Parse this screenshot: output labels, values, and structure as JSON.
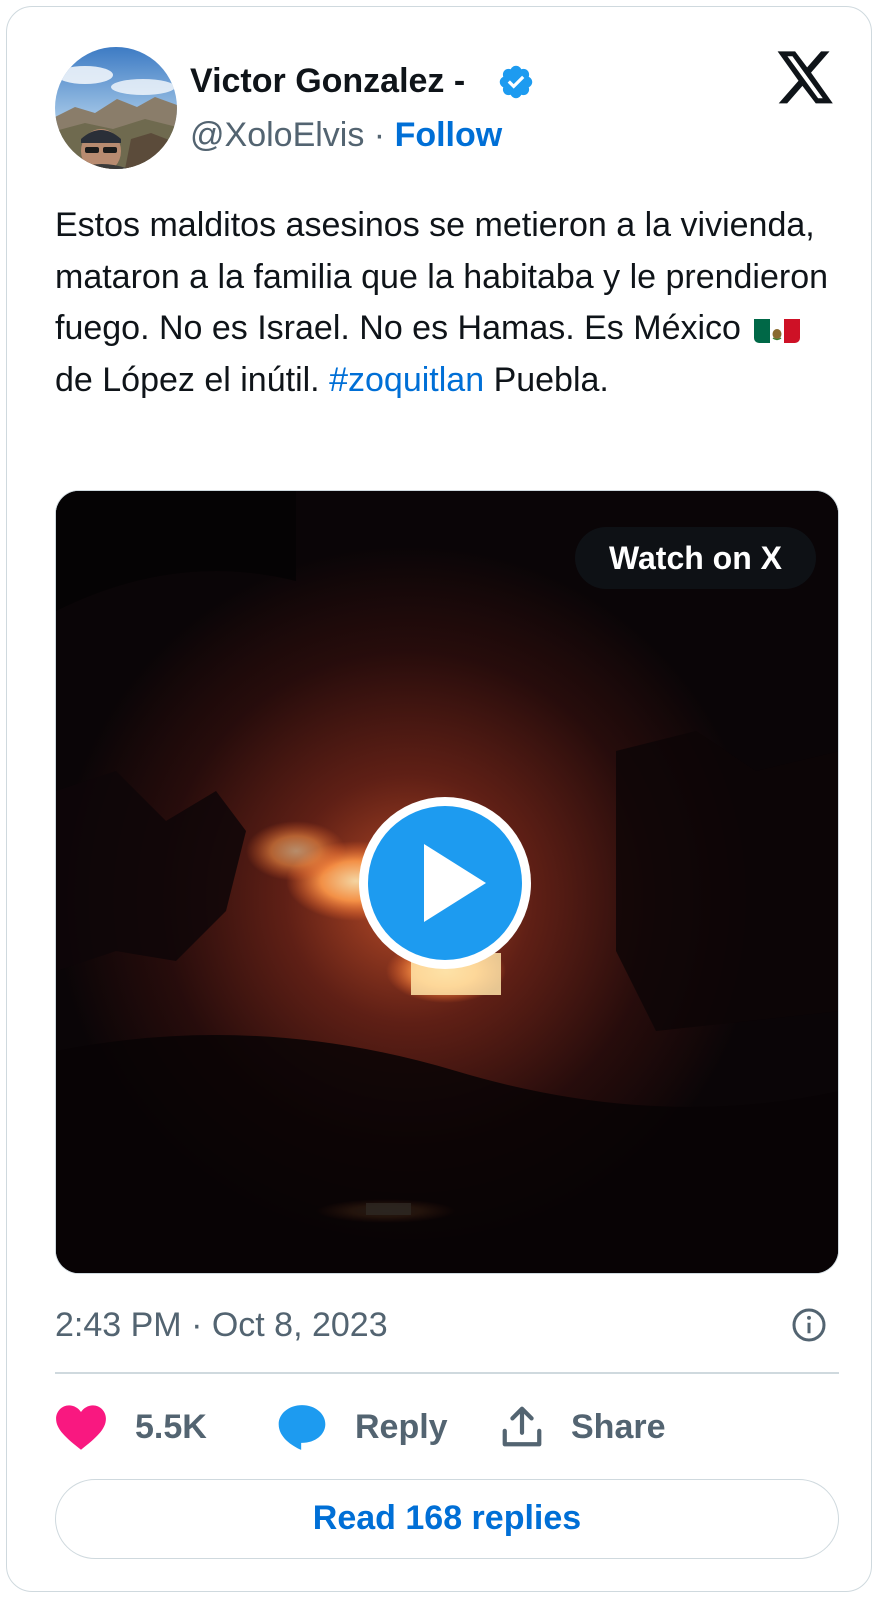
{
  "author": {
    "name": "Victor Gonzalez -",
    "handle": "@XoloElvis",
    "separator": " · ",
    "follow_label": "Follow",
    "verified": true,
    "avatar_icon": "profile-photo"
  },
  "brand": {
    "logo_icon": "x-logo-icon"
  },
  "tweet": {
    "text_part1": "Estos malditos asesinos se metieron a la vivienda, mataron a la familia que la habitaba y le prendieron fuego. No es Israel. No es Hamas. Es México",
    "flag_emoji": "🇲🇽",
    "text_part2": "de López el inútil.",
    "hashtag": "#zoquitlan",
    "text_part3": "Puebla."
  },
  "media": {
    "watch_label": "Watch on X",
    "play_icon": "play-icon"
  },
  "meta": {
    "timestamp": "2:43 PM · Oct 8, 2023",
    "info_icon": "info-icon"
  },
  "actions": {
    "likes_count": "5.5K",
    "reply_label": "Reply",
    "share_label": "Share"
  },
  "footer": {
    "read_replies_label": "Read 168 replies"
  },
  "colors": {
    "link_blue": "#006fd6",
    "verified_blue": "#1d9bf0",
    "like_pink": "#f91880",
    "muted_text": "#536471",
    "border": "#cfd9de"
  }
}
